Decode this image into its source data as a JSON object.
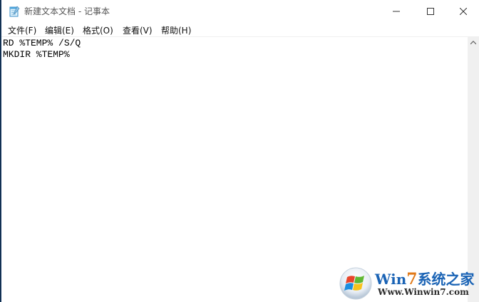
{
  "window": {
    "title": "新建文本文档 - 记事本",
    "icon": "notepad-icon"
  },
  "controls": {
    "minimize_icon": "minimize-icon",
    "maximize_icon": "maximize-icon",
    "close_icon": "close-icon"
  },
  "menu": {
    "items": [
      {
        "label": "文件(F)"
      },
      {
        "label": "编辑(E)"
      },
      {
        "label": "格式(O)"
      },
      {
        "label": "查看(V)"
      },
      {
        "label": "帮助(H)"
      }
    ]
  },
  "editor": {
    "lines": [
      "RD %TEMP% /S/Q",
      "MKDIR %TEMP%"
    ]
  },
  "watermark": {
    "brand_prefix": "Win",
    "brand_seven": "7",
    "brand_suffix": "系统之家",
    "url": "Www.Winwin7.com"
  },
  "colors": {
    "accent_blue": "#1a63b5",
    "accent_orange": "#e07a1a",
    "desktop": "#0c2a4a"
  }
}
